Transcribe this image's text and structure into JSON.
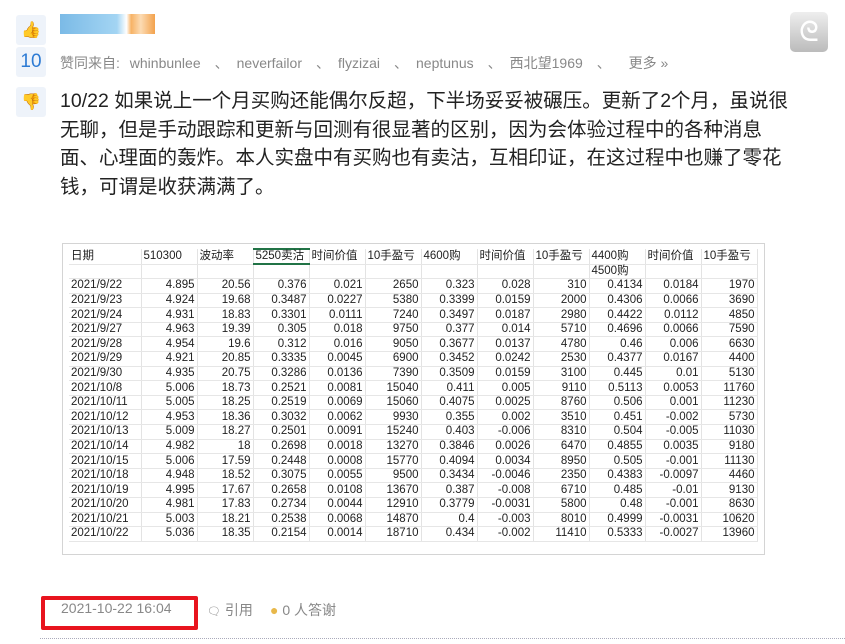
{
  "post": {
    "like_count": "10",
    "likes_label": "赞同来自:",
    "likers": [
      "whinbunlee",
      "neverfailor",
      "flyzizai",
      "neptunus",
      "西北望1969"
    ],
    "separator": "、",
    "more": "更多 »",
    "body": "10/22 如果说上一个月买购还能偶尔反超，下半场妥妥被碾压。更新了2个月，虽说很无聊，但是手动跟踪和更新与回测有很显著的区别，因为会体验过程中的各种消息面、心理面的轰炸。本人实盘中有买购也有卖沽，互相印证，在这过程中也赚了零花钱，可谓是收获满满了。",
    "timestamp": "2021-10-22 16:04",
    "quote": "引用",
    "thanks": "0 人答谢"
  },
  "sheet": {
    "headers": [
      "日期",
      "510300",
      "波动率",
      "5250卖沽",
      "时间价值",
      "10手盈亏",
      "4600购",
      "时间价值",
      "10手盈亏",
      "4400购",
      "时间价值",
      "10手盈亏"
    ],
    "subheader": "4500购",
    "rows": [
      [
        "2021/9/22",
        "4.895",
        "20.56",
        "0.376",
        "0.021",
        "2650",
        "0.323",
        "0.028",
        "310",
        "0.4134",
        "0.0184",
        "1970"
      ],
      [
        "2021/9/23",
        "4.924",
        "19.68",
        "0.3487",
        "0.0227",
        "5380",
        "0.3399",
        "0.0159",
        "2000",
        "0.4306",
        "0.0066",
        "3690"
      ],
      [
        "2021/9/24",
        "4.931",
        "18.83",
        "0.3301",
        "0.0111",
        "7240",
        "0.3497",
        "0.0187",
        "2980",
        "0.4422",
        "0.0112",
        "4850"
      ],
      [
        "2021/9/27",
        "4.963",
        "19.39",
        "0.305",
        "0.018",
        "9750",
        "0.377",
        "0.014",
        "5710",
        "0.4696",
        "0.0066",
        "7590"
      ],
      [
        "2021/9/28",
        "4.954",
        "19.6",
        "0.312",
        "0.016",
        "9050",
        "0.3677",
        "0.0137",
        "4780",
        "0.46",
        "0.006",
        "6630"
      ],
      [
        "2021/9/29",
        "4.921",
        "20.85",
        "0.3335",
        "0.0045",
        "6900",
        "0.3452",
        "0.0242",
        "2530",
        "0.4377",
        "0.0167",
        "4400"
      ],
      [
        "2021/9/30",
        "4.935",
        "20.75",
        "0.3286",
        "0.0136",
        "7390",
        "0.3509",
        "0.0159",
        "3100",
        "0.445",
        "0.01",
        "5130"
      ],
      [
        "2021/10/8",
        "5.006",
        "18.73",
        "0.2521",
        "0.0081",
        "15040",
        "0.411",
        "0.005",
        "9110",
        "0.5113",
        "0.0053",
        "11760"
      ],
      [
        "2021/10/11",
        "5.005",
        "18.25",
        "0.2519",
        "0.0069",
        "15060",
        "0.4075",
        "0.0025",
        "8760",
        "0.506",
        "0.001",
        "11230"
      ],
      [
        "2021/10/12",
        "4.953",
        "18.36",
        "0.3032",
        "0.0062",
        "9930",
        "0.355",
        "0.002",
        "3510",
        "0.451",
        "-0.002",
        "5730"
      ],
      [
        "2021/10/13",
        "5.009",
        "18.27",
        "0.2501",
        "0.0091",
        "15240",
        "0.403",
        "-0.006",
        "8310",
        "0.504",
        "-0.005",
        "11030"
      ],
      [
        "2021/10/14",
        "4.982",
        "18",
        "0.2698",
        "0.0018",
        "13270",
        "0.3846",
        "0.0026",
        "6470",
        "0.4855",
        "0.0035",
        "9180"
      ],
      [
        "2021/10/15",
        "5.006",
        "17.59",
        "0.2448",
        "0.0008",
        "15770",
        "0.4094",
        "0.0034",
        "8950",
        "0.505",
        "-0.001",
        "11130"
      ],
      [
        "2021/10/18",
        "4.948",
        "18.52",
        "0.3075",
        "0.0055",
        "9500",
        "0.3434",
        "-0.0046",
        "2350",
        "0.4383",
        "-0.0097",
        "4460"
      ],
      [
        "2021/10/19",
        "4.995",
        "17.67",
        "0.2658",
        "0.0108",
        "13670",
        "0.387",
        "-0.008",
        "6710",
        "0.485",
        "-0.01",
        "9130"
      ],
      [
        "2021/10/20",
        "4.981",
        "17.83",
        "0.2734",
        "0.0044",
        "12910",
        "0.3779",
        "-0.0031",
        "5800",
        "0.48",
        "-0.001",
        "8630"
      ],
      [
        "2021/10/21",
        "5.003",
        "18.21",
        "0.2538",
        "0.0068",
        "14870",
        "0.4",
        "-0.003",
        "8010",
        "0.4999",
        "-0.0031",
        "10620"
      ],
      [
        "2021/10/22",
        "5.036",
        "18.35",
        "0.2154",
        "0.0014",
        "18710",
        "0.434",
        "-0.002",
        "11410",
        "0.5333",
        "-0.0027",
        "13960"
      ]
    ]
  }
}
